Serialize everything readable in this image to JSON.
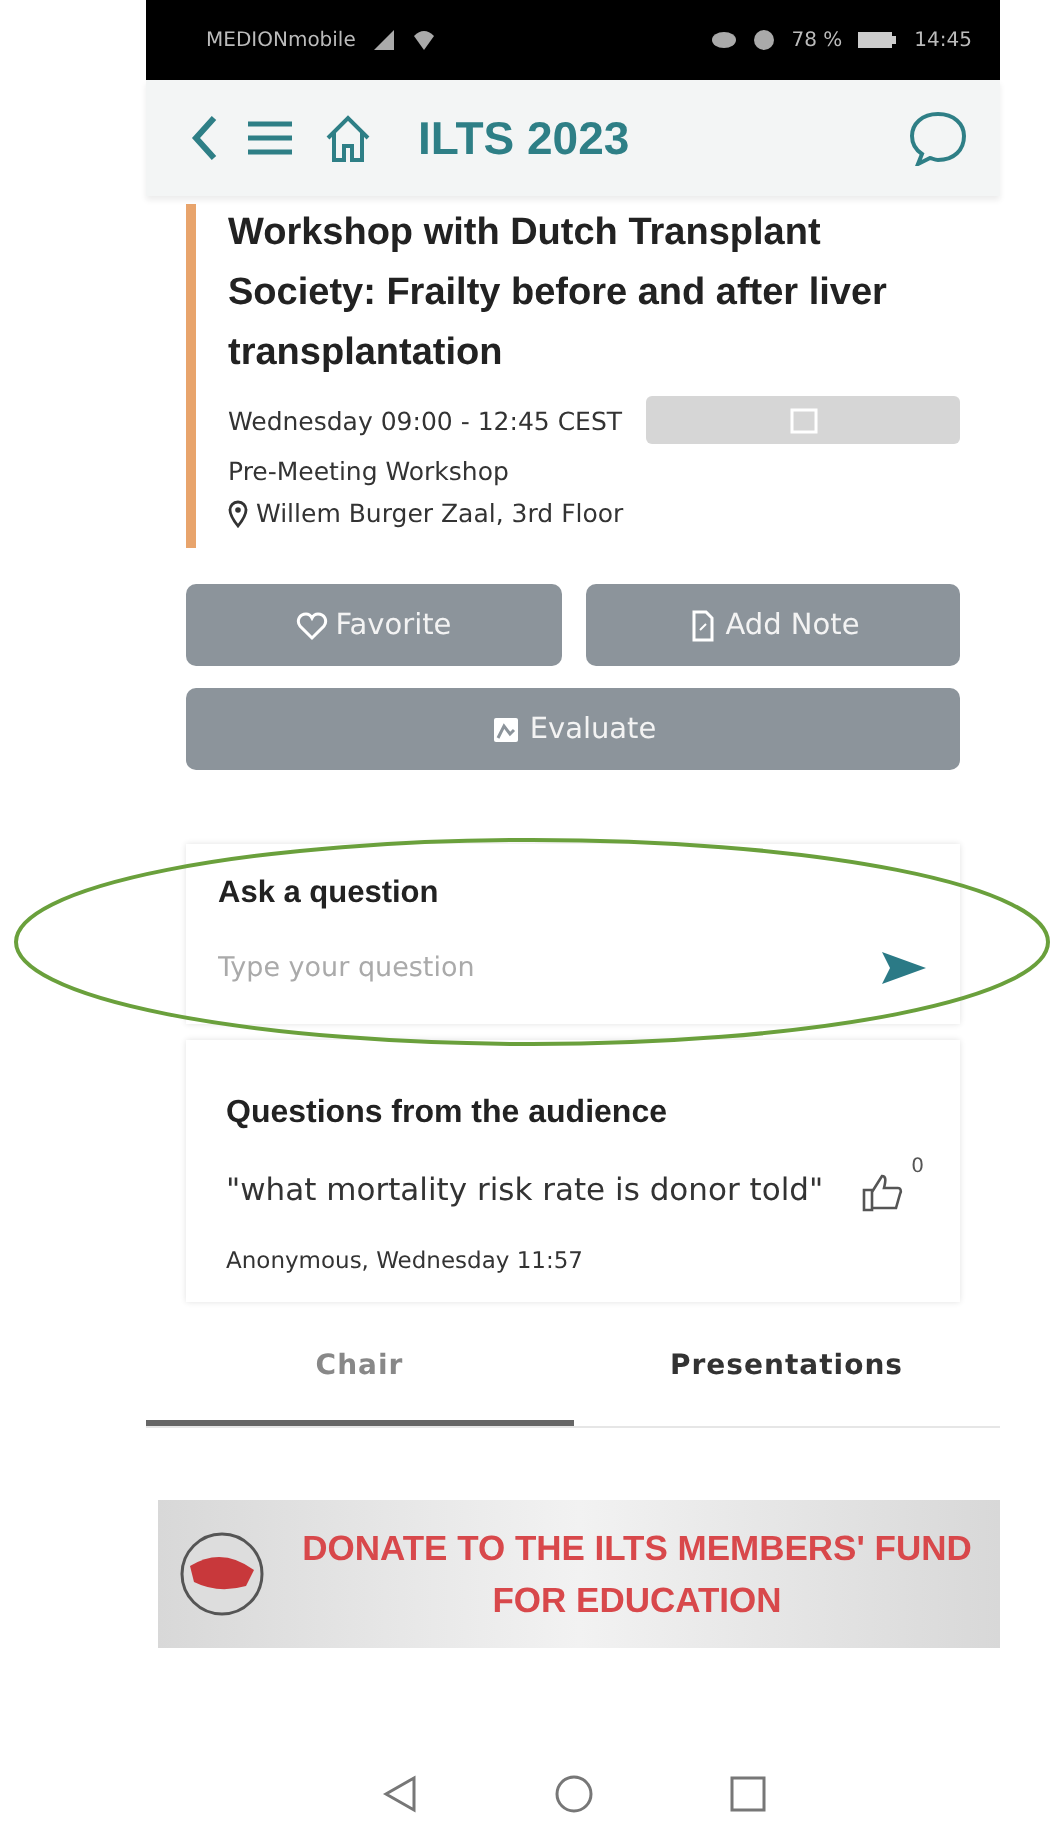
{
  "status_bar": {
    "carrier": "MEDIONmobile",
    "battery": "78 %",
    "time": "14:45"
  },
  "header": {
    "title": "ILTS 2023"
  },
  "session": {
    "title": "Workshop with Dutch Transplant Society: Frailty before and after liver transplantation",
    "time": "Wednesday 09:00 - 12:45 CEST",
    "type": "Pre-Meeting Workshop",
    "location": "Willem Burger Zaal, 3rd Floor",
    "color": "#e8a46c"
  },
  "actions": [
    {
      "label": "Favorite",
      "kind": "heart"
    },
    {
      "label": "Add Note",
      "kind": "note"
    },
    {
      "label": "Evaluate",
      "kind": "evaluate"
    }
  ],
  "ask": {
    "title": "Ask a question",
    "placeholder": "Type your question"
  },
  "audience": {
    "title": "Questions from the audience",
    "questions": [
      {
        "text": "\"what mortality risk rate is donor told\"",
        "meta": "Anonymous, Wednesday 11:57",
        "likes": "0"
      }
    ]
  },
  "tabs": [
    {
      "label": "Chair",
      "selected": true
    },
    {
      "label": "Presentations",
      "selected": false
    }
  ],
  "banner": {
    "text": "DONATE TO THE ILTS MEMBERS' FUND FOR EDUCATION"
  }
}
